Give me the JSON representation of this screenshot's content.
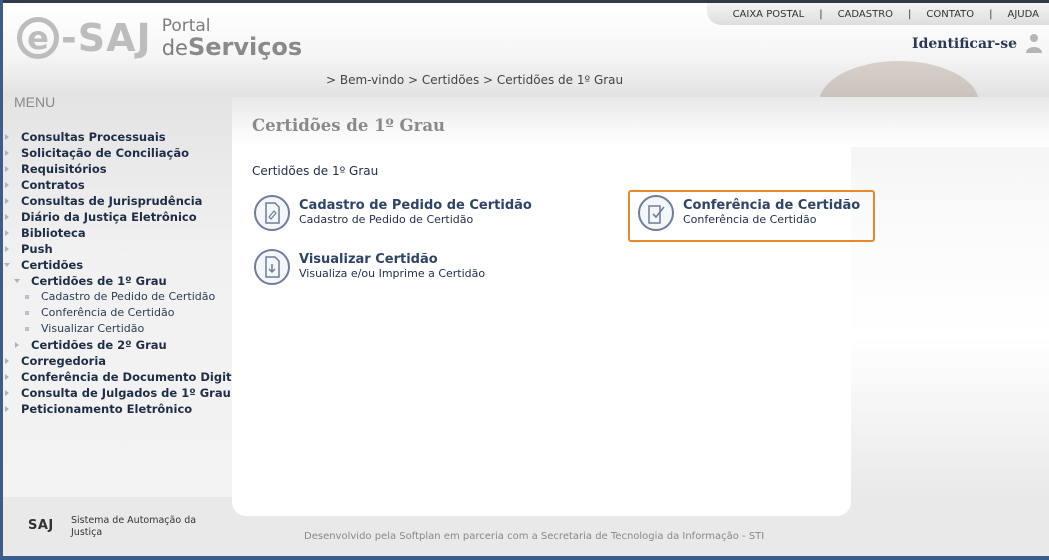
{
  "header": {
    "logo_esaj": "-SAJ",
    "logo_e": "e",
    "logo_portal_line1": "Portal",
    "logo_portal_de": "de",
    "logo_portal_servicos": "Serviços",
    "top_nav": [
      "CAIXA POSTAL",
      "CADASTRO",
      "CONTATO",
      "AJUDA"
    ],
    "top_nav_sep": "|",
    "identificar": "Identificar-se",
    "breadcrumb": "> Bem-vindo > Certidões > Certidões de 1º Grau"
  },
  "sidebar": {
    "title": "MENU",
    "items": [
      {
        "label": "Consultas Processuais",
        "level": 1,
        "arrow": "right"
      },
      {
        "label": "Solicitação de Conciliação",
        "level": 1,
        "arrow": "right"
      },
      {
        "label": "Requisitórios",
        "level": 1,
        "arrow": "right"
      },
      {
        "label": "Contratos",
        "level": 1,
        "arrow": "right"
      },
      {
        "label": "Consultas de Jurisprudência",
        "level": 1,
        "arrow": "right"
      },
      {
        "label": "Diário da Justiça Eletrônico",
        "level": 1,
        "arrow": "right"
      },
      {
        "label": "Biblioteca",
        "level": 1,
        "arrow": "right"
      },
      {
        "label": "Push",
        "level": 1,
        "arrow": "right"
      },
      {
        "label": "Certidões",
        "level": 1,
        "arrow": "down"
      },
      {
        "label": "Certidões de 1º Grau",
        "level": 2,
        "arrow": "down"
      },
      {
        "label": "Cadastro de Pedido de Certidão",
        "level": 3
      },
      {
        "label": "Conferência de Certidão",
        "level": 3
      },
      {
        "label": "Visualizar Certidão",
        "level": 3
      },
      {
        "label": "Certidões de 2º Grau",
        "level": 2,
        "arrow": "right"
      },
      {
        "label": "Corregedoria",
        "level": 1,
        "arrow": "right"
      },
      {
        "label": "Conferência de Documento Digital",
        "level": 1,
        "arrow": "right"
      },
      {
        "label": "Consulta de Julgados de 1º Grau",
        "level": 1,
        "arrow": "right"
      },
      {
        "label": "Peticionamento Eletrônico",
        "level": 1,
        "arrow": "right"
      }
    ]
  },
  "main": {
    "page_title": "Certidões de 1º Grau",
    "section_label": "Certidões de 1º Grau",
    "options": [
      {
        "title": "Cadastro de Pedido de Certidão",
        "subtitle": "Cadastro de Pedido de Certidão"
      },
      {
        "title": "Conferência de Certidão",
        "subtitle": "Conferência de Certidão"
      },
      {
        "title": "Visualizar Certidão",
        "subtitle": "Visualiza e/ou Imprime a Certidão"
      }
    ]
  },
  "footer": {
    "logo": "SAJ",
    "system": "Sistema de Automação da Justiça",
    "developed": "Desenvolvido pela Softplan em parceria com a Secretaria de Tecnologia da Informação - STI"
  },
  "colors": {
    "highlight": "#e98a2a",
    "nav_text": "#1e2e49",
    "accent_blue": "#3a5d8c"
  }
}
